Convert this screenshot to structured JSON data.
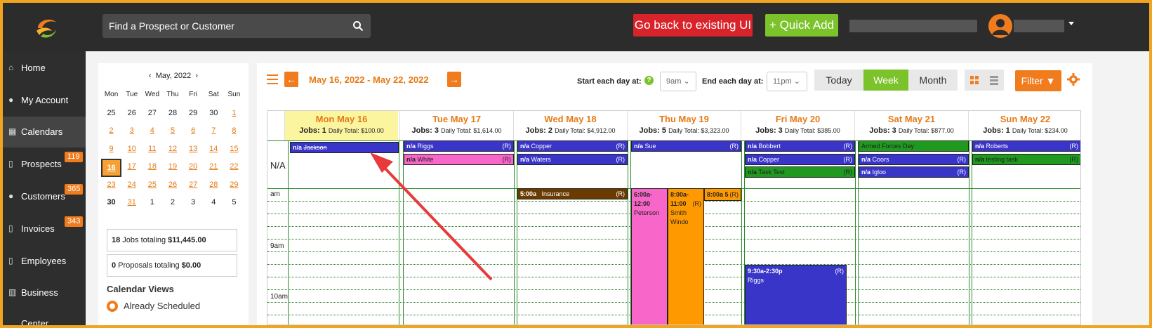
{
  "header": {
    "search_placeholder": "Find a Prospect or Customer",
    "back_button": "Go back to existing UI",
    "quick_add": "+ Quick Add"
  },
  "sidebar": {
    "items": [
      {
        "label": "Home",
        "icon": "home-icon"
      },
      {
        "label": "My Account",
        "icon": "user-icon"
      },
      {
        "label": "Calendars",
        "icon": "calendar-icon"
      },
      {
        "label": "Prospects",
        "icon": "file-icon",
        "badge": "119"
      },
      {
        "label": "Customers",
        "icon": "users-icon",
        "badge": "365"
      },
      {
        "label": "Invoices",
        "icon": "file-icon",
        "badge": "343"
      },
      {
        "label": "Employees",
        "icon": "file-icon"
      },
      {
        "label": "Business Center",
        "icon": "building-icon"
      }
    ]
  },
  "mini_calendar": {
    "month": "May, 2022",
    "dow": [
      "Mon",
      "Tue",
      "Wed",
      "Thu",
      "Fri",
      "Sat",
      "Sun"
    ],
    "weeks": [
      [
        "25",
        "26",
        "27",
        "28",
        "29",
        "30",
        "1"
      ],
      [
        "2",
        "3",
        "4",
        "5",
        "6",
        "7",
        "8"
      ],
      [
        "9",
        "10",
        "11",
        "12",
        "13",
        "14",
        "15"
      ],
      [
        "16",
        "17",
        "18",
        "19",
        "20",
        "21",
        "22"
      ],
      [
        "23",
        "24",
        "25",
        "26",
        "27",
        "28",
        "29"
      ],
      [
        "30",
        "31",
        "1",
        "2",
        "3",
        "4",
        "5"
      ]
    ],
    "selected": "16"
  },
  "totals": {
    "jobs_count": "18",
    "jobs_text": " Jobs totaling ",
    "jobs_amount": "$11,445.00",
    "proposals_count": "0",
    "proposals_text": " Proposals totaling ",
    "proposals_amount": "$0.00"
  },
  "calendar_views": {
    "title": "Calendar Views",
    "option": "Already Scheduled"
  },
  "toolbar": {
    "date_range": "May 16, 2022 - May 22, 2022",
    "start_label": "Start each day at:",
    "start_value": "9am",
    "end_label": "End each day at:",
    "end_value": "11pm",
    "today": "Today",
    "week": "Week",
    "month": "Month",
    "filter": "Filter"
  },
  "days": [
    {
      "name": "Mon May 16",
      "jobs": "Jobs: 1",
      "total": "Daily Total: $100.00"
    },
    {
      "name": "Tue May 17",
      "jobs": "Jobs: 3",
      "total": "Daily Total: $1,614.00"
    },
    {
      "name": "Wed May 18",
      "jobs": "Jobs: 2",
      "total": "Daily Total: $4,912.00"
    },
    {
      "name": "Thu May 19",
      "jobs": "Jobs: 5",
      "total": "Daily Total: $3,323.00"
    },
    {
      "name": "Fri May 20",
      "jobs": "Jobs: 3",
      "total": "Daily Total: $385.00"
    },
    {
      "name": "Sat May 21",
      "jobs": "Jobs: 3",
      "total": "Daily Total: $877.00"
    },
    {
      "name": "Sun May 22",
      "jobs": "Jobs: 1",
      "total": "Daily Total: $234.00"
    }
  ],
  "grid": {
    "na": "N/A",
    "am": "am",
    "t9": "9am",
    "t10": "10am"
  },
  "events": {
    "mon1": {
      "prefix": "n/a",
      "name": "Jackson"
    },
    "tue1": {
      "prefix": "n/a",
      "name": "Riggs",
      "r": "(R)"
    },
    "tue2": {
      "prefix": "n/a",
      "name": "White",
      "r": "(R)"
    },
    "wed1": {
      "prefix": "n/a",
      "name": "Copper",
      "r": "(R)"
    },
    "wed2": {
      "prefix": "n/a",
      "name": "Waters",
      "r": "(R)"
    },
    "wed3": {
      "time": "5:00a",
      "name": "Insurance",
      "r": "(R)"
    },
    "thu1": {
      "prefix": "n/a",
      "name": "Sue",
      "r": "(R)"
    },
    "thu2": {
      "time": "6:00a-12:00",
      "name": "Peterson"
    },
    "thu3": {
      "time": "8:00a-11:00",
      "name": "Smith Windo",
      "r": "(R)"
    },
    "thu4": {
      "time": "8:00a",
      "mid": "5",
      "r": "(R)"
    },
    "fri1": {
      "prefix": "n/a",
      "name": "Bobbert",
      "r": "(R)"
    },
    "fri2": {
      "prefix": "n/a",
      "name": "Copper",
      "r": "(R)"
    },
    "fri3": {
      "prefix": "n/a",
      "name": "Task Test",
      "r": "(R)"
    },
    "fri4": {
      "time": "9:30a-2:30p",
      "name": "Riggs",
      "r": "(R)"
    },
    "sat1": {
      "name": "Armed Forces Day"
    },
    "sat2": {
      "prefix": "n/a",
      "name": "Coors",
      "r": "(R)"
    },
    "sat3": {
      "prefix": "n/a",
      "name": "Igloo",
      "r": "(R)"
    },
    "sun1": {
      "prefix": "n/a",
      "name": "Roberts",
      "r": "(R)"
    },
    "sun2": {
      "prefix": "n/a",
      "name": "testing task",
      "r": "(R)"
    }
  },
  "colors": {
    "accent": "#f07c1e",
    "green": "#7cc22b",
    "red": "#d8232a",
    "event_blue": "#3a35c9"
  }
}
